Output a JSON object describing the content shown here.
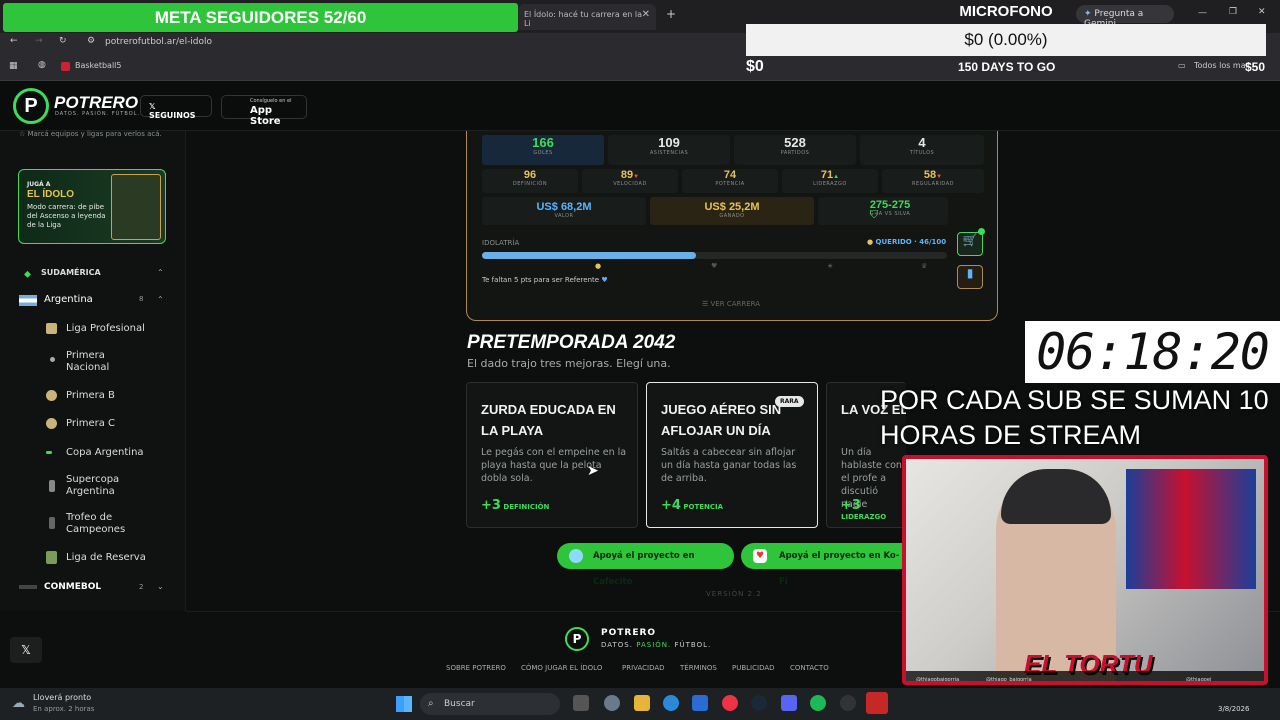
{
  "browser": {
    "tab_title": "El Ídolo: hacé tu carrera en la Li",
    "url": "potrerofutbol.ar/el-idolo",
    "bookmark": "Basketball5",
    "gemini": "Pregunta a Gemini",
    "all_bookmarks": "Todos los mar"
  },
  "site": {
    "brand": "POTRERO",
    "tagline": "DATOS. PASIÓN. FÚTBOL.",
    "x_button": "SEGUINOS",
    "app_store_small": "Consíguelo en el",
    "app_store": "App Store"
  },
  "sidebar": {
    "hint": "Marcá equipos y ligas para verlos acá.",
    "promo_small": "JUGÁ A",
    "promo_title": "EL ÍDOLO",
    "promo_desc": "Modo carrera: de pibe del Ascenso a leyenda de la Liga",
    "region": "SUDAMÉRICA",
    "country": "Argentina",
    "country_count": "8",
    "leagues": [
      "Liga Profesional",
      "Primera Nacional",
      "Primera B",
      "Primera C",
      "Copa Argentina",
      "Supercopa Argentina",
      "Trofeo de Campeones",
      "Liga de Reserva"
    ],
    "conmebol": "CONMEBOL",
    "conmebol_count": "2"
  },
  "stats": {
    "goles": {
      "v": "166",
      "l": "GOLES"
    },
    "asistencias": {
      "v": "109",
      "l": "ASISTENCIAS"
    },
    "partidos": {
      "v": "528",
      "l": "PARTIDOS"
    },
    "titulos": {
      "v": "4",
      "l": "TÍTULOS"
    },
    "definicion": {
      "v": "96",
      "l": "DEFINICIÓN"
    },
    "velocidad": {
      "v": "89",
      "l": "VELOCIDAD"
    },
    "potencia": {
      "v": "74",
      "l": "POTENCIA"
    },
    "liderazgo": {
      "v": "71",
      "l": "LIDERAZGO"
    },
    "regularidad": {
      "v": "58",
      "l": "REGULARIDAD"
    },
    "valor": {
      "v": "US$ 68,2M",
      "l": "VALOR"
    },
    "ganado": {
      "v": "US$ 25,2M",
      "l": "GANADO"
    },
    "rival": {
      "v": "275-275",
      "l": "G+A VS SILVA"
    },
    "idolatria_label": "IDOLATRÍA",
    "idolatria_status": "QUERIDO · 46/100",
    "idolatria_progress": 0.46,
    "idolatria_hint": "Te faltan 5 pts para ser Referente",
    "ver_carrera": "VER CARRERA"
  },
  "pretemporada": {
    "title": "PRETEMPORADA 2042",
    "subtitle": "El dado trajo tres mejoras. Elegí una.",
    "options": [
      {
        "title": "ZURDA EDUCADA EN LA PLAYA",
        "desc": "Le pegás con el empeine en la playa hasta que la pelota dobla sola.",
        "bonus": "+3",
        "stat": "DEFINICIÓN",
        "badge": ""
      },
      {
        "title": "JUEGO AÉREO SIN AFLOJAR UN DÍA",
        "desc": "Saltás a cabecear sin aflojar un día hasta ganar todas las de arriba.",
        "bonus": "+4",
        "stat": "POTENCIA",
        "badge": "RARA"
      },
      {
        "title": "LA VOZ EL PROF",
        "desc": "Un día hablaste con el profe a discutió nadie",
        "bonus": "+3",
        "stat": "LIDERAZGO",
        "badge": ""
      }
    ],
    "cafecito": "Apoyá el proyecto en Cafecito",
    "kofi": "Apoyá el proyecto en Ko-Fi",
    "version": "VERSIÓN 2.2"
  },
  "footer": {
    "brand": "POTRERO",
    "tag1": "DATOS.",
    "tag2": "PASIÓN.",
    "tag3": "FÚTBOL.",
    "links": [
      "SOBRE POTRERO",
      "CÓMO JUGAR EL ÍDOLO",
      "PRIVACIDAD",
      "TÉRMINOS",
      "PUBLICIDAD",
      "CONTACTO"
    ]
  },
  "taskbar": {
    "weather": "Lloverá pronto",
    "weather_sub": "En aprox. 2 horas",
    "search": "Buscar",
    "date": "3/8/2026"
  },
  "overlay": {
    "meta": "META SEGUIDORES 52/60",
    "microfono": "MICROFONO",
    "goal_amount": "$0 (0.00%)",
    "goal_left": "$0",
    "days": "150 DAYS TO GO",
    "goal_right": "$50",
    "timer": "06:18:20",
    "sub_text": "POR CADA SUB SE SUMAN 10 HORAS DE STREAM",
    "cam_name": "EL TORTU",
    "handle1": "@thiagobaigorria_",
    "handle2": "@thiago_baigorria",
    "handle3": "@thiagoei_"
  },
  "colors": {
    "accent": "#3ddc5a",
    "gold": "#e5c25a",
    "border": "#b08a55",
    "cam_border": "#c8102e"
  }
}
